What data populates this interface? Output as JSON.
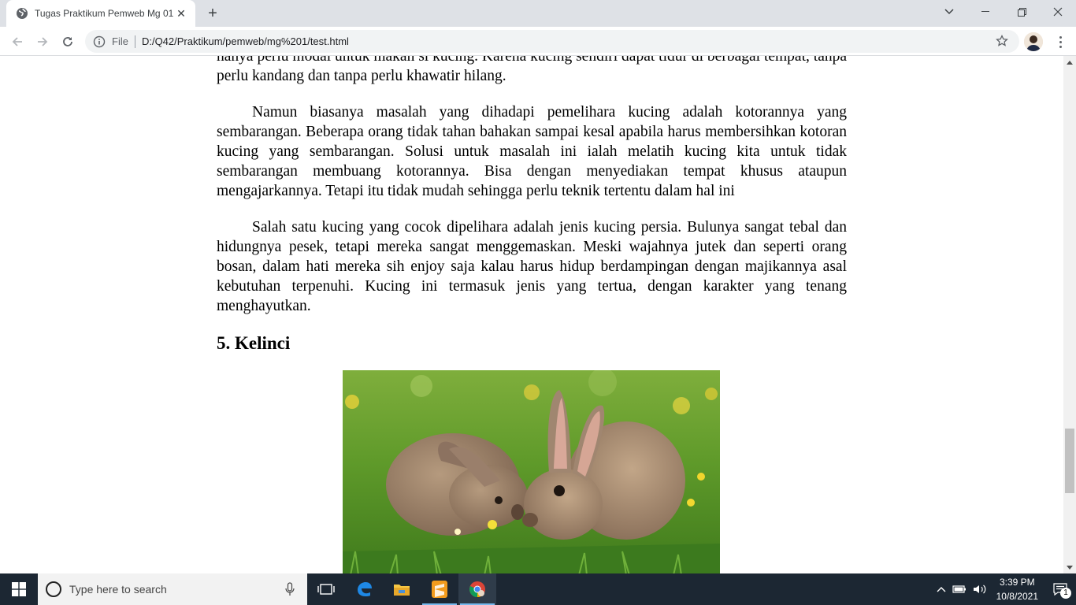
{
  "browser": {
    "tab_title": "Tugas Praktikum Pemweb Mg 01",
    "scheme_label": "File",
    "url": "D:/Q42/Praktikum/pemweb/mg%201/test.html"
  },
  "article": {
    "paragraph_top": "hanya perlu modal untuk makan si kucing. Karena kucing sendiri dapat tidur di berbagai tempat, tanpa perlu kandang dan tanpa perlu khawatir hilang.",
    "paragraph_2": "Namun biasanya masalah yang dihadapi pemelihara kucing adalah kotorannya yang sembarangan. Beberapa orang tidak tahan bahakan sampai kesal apabila harus membersihkan kotoran kucing yang sembarangan. Solusi untuk masalah ini ialah melatih kucing kita untuk tidak sembarangan membuang kotorannya. Bisa dengan menyediakan tempat khusus ataupun mengajarkannya. Tetapi itu tidak mudah sehingga perlu teknik tertentu dalam hal ini",
    "paragraph_3": "Salah satu kucing yang cocok dipelihara adalah jenis kucing persia. Bulunya sangat tebal dan hidungnya pesek, tetapi mereka sangat menggemaskan. Meski wajahnya jutek dan seperti orang bosan, dalam hati mereka sih enjoy saja kalau harus hidup berdampingan dengan majikannya asal kebutuhan terpenuhi. Kucing ini termasuk jenis yang tertua, dengan karakter yang tenang menghayutkan.",
    "heading": "5. Kelinci"
  },
  "taskbar": {
    "search_placeholder": "Type here to search",
    "time": "3:39 PM",
    "date": "10/8/2021",
    "notification_count": "1"
  }
}
